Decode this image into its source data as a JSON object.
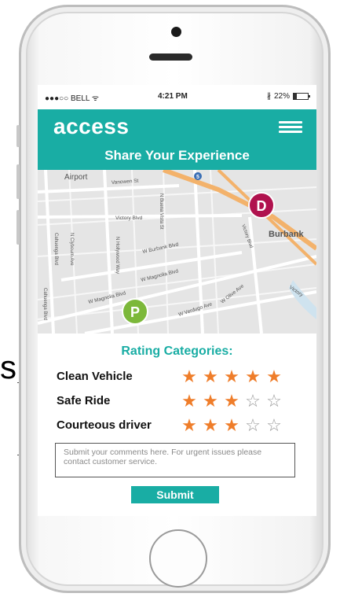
{
  "annotation": {
    "fragment": "s"
  },
  "status_bar": {
    "carrier": "●●●○○ BELL ᯤ",
    "time": "4:21 PM",
    "battery": "22%"
  },
  "header": {
    "brand": "access",
    "title": "Share Your Experience",
    "menu_icon": "hamburger-menu-icon"
  },
  "map": {
    "labels": {
      "airport": "Airport",
      "vanowen": "Vanowen St",
      "victory_blvd": "Victory Blvd",
      "burbank": "Burbank",
      "burbank_blvd": "W Burbank Blvd",
      "magnolia": "W Magnolia Blvd",
      "magnolia2": "W Magnolia Blvd",
      "verdugo": "W Verdugo Ave",
      "olive": "W Olive Ave",
      "victory2": "Victory",
      "cahuenga": "Cahuenga Blvd",
      "n_clybourn": "N Clybourn Ave",
      "n_hollywood": "N Hollywood Way",
      "n_buena": "N Buena Vista St",
      "n_victory": "Victory Blvd",
      "cahuenga2": "Cahuenga Blvd",
      "highway": "5"
    },
    "markers": {
      "dropoff": "D",
      "pickup": "P"
    },
    "colors": {
      "dropoff": "#b0124e",
      "pickup": "#7cb83a",
      "freeway": "#f3b26b"
    }
  },
  "ratings": {
    "title": "Rating Categories:",
    "items": [
      {
        "label": "Clean Vehicle",
        "score": 5,
        "max": 5
      },
      {
        "label": "Safe Ride",
        "score": 3,
        "max": 5
      },
      {
        "label": "Courteous driver",
        "score": 3,
        "max": 5
      }
    ],
    "star_full": "★",
    "star_empty": "☆",
    "colors": {
      "full": "#ef7d2a",
      "empty": "#9a9a9a"
    }
  },
  "comments": {
    "placeholder": "Submit your comments here. For urgent issues please contact customer service."
  },
  "submit": {
    "label": "Submit"
  },
  "theme": {
    "accent": "#19ada4"
  }
}
